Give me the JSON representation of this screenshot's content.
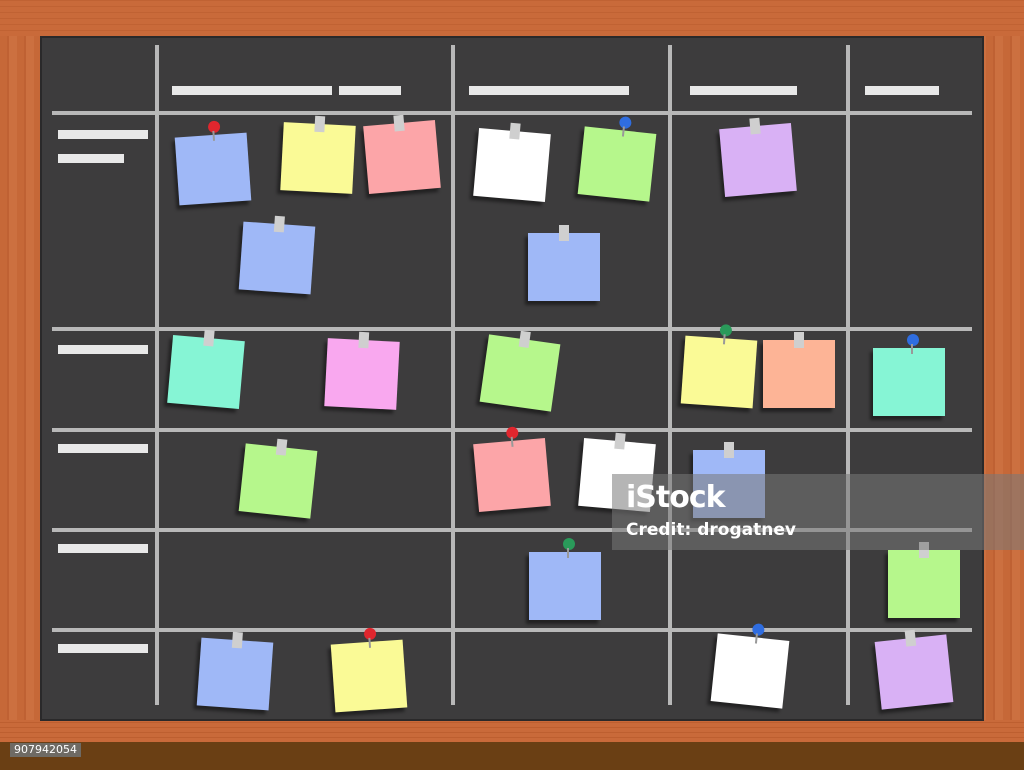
{
  "palette": {
    "frame": "#c8693a",
    "board": "#3d3c3d",
    "blue": "#9fb8f7",
    "yellow": "#fafa96",
    "pink": "#fca5a8",
    "white": "#ffffff",
    "green": "#b6f78c",
    "purple": "#d9b1f5",
    "teal": "#86f5d5",
    "magenta": "#f9a8ef",
    "orange": "#fdb496"
  },
  "watermark": {
    "logo": "iStock",
    "credit": "Credit: drogatnev"
  },
  "image_id": "907942054"
}
